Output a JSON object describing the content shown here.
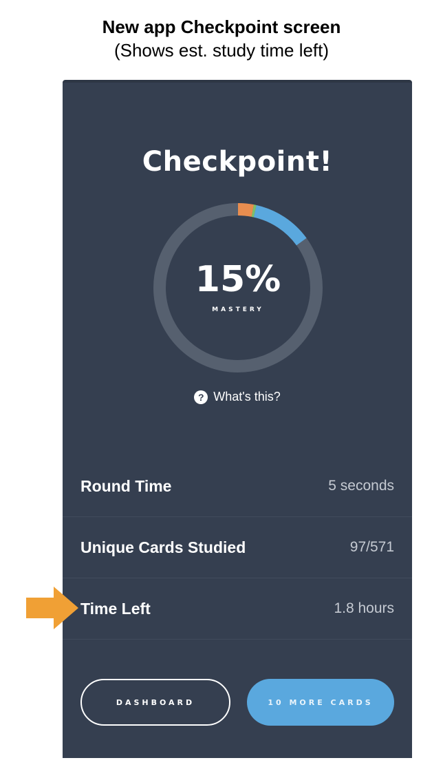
{
  "caption": {
    "title": "New app Checkpoint screen",
    "subtitle": "(Shows est. study time left)"
  },
  "screen": {
    "heading": "Checkpoint!",
    "progress": {
      "percent_label": "15%",
      "label": "MASTERY",
      "mastered_fraction": 0.15,
      "segments": [
        {
          "name": "orange",
          "fraction": 0.03,
          "color": "#e88d4f"
        },
        {
          "name": "green",
          "fraction": 0.005,
          "color": "#7dbf6a"
        },
        {
          "name": "blue",
          "fraction": 0.115,
          "color": "#5aa8de"
        }
      ],
      "track_color": "#56606f"
    },
    "help_link": "What's this?",
    "stats": [
      {
        "label": "Round Time",
        "value": "5 seconds"
      },
      {
        "label": "Unique Cards Studied",
        "value": "97/571"
      },
      {
        "label": "Time Left",
        "value": "1.8 hours"
      }
    ],
    "buttons": {
      "dashboard": "DASHBOARD",
      "more_cards": "10 MORE CARDS"
    }
  },
  "colors": {
    "background": "#353f50",
    "accent": "#5aa8de",
    "arrow": "#f0a035"
  }
}
